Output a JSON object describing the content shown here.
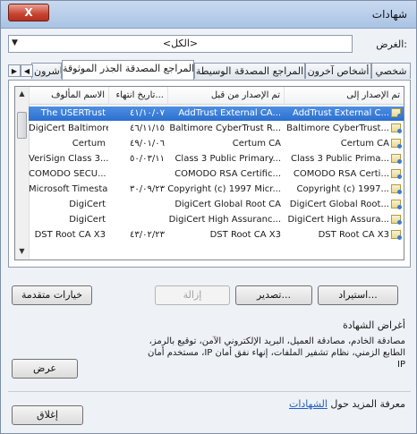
{
  "window": {
    "title": "شهادات",
    "close_label": "X"
  },
  "purpose": {
    "label": "الغرض:",
    "selected": "<الكل>"
  },
  "tabs": [
    {
      "label": "شخصي"
    },
    {
      "label": "أشخاص آخرون"
    },
    {
      "label": "المراجع المصدقة الوسيطة"
    },
    {
      "label": "المراجع المصدقة الجذر الموثوقة"
    },
    {
      "label": "الناشرون"
    }
  ],
  "table": {
    "columns": [
      "تم الإصدار إلى",
      "تم الإصدار من قبل",
      "تاريخ انتهاء...",
      "الاسم المألوف"
    ],
    "rows": [
      {
        "issued_to": "AddTrust External C...",
        "issued_by": "AddTrust External CA...",
        "expiry": "٤١/١٠/٠٧",
        "friendly": "The USERTrust"
      },
      {
        "issued_to": "Baltimore CyberTrust...",
        "issued_by": "Baltimore CyberTrust R...",
        "expiry": "٤٦/١١/١٥",
        "friendly": "DigiCert Baltimore..."
      },
      {
        "issued_to": "Certum CA",
        "issued_by": "Certum CA",
        "expiry": "٤٩/٠١/٠٦",
        "friendly": "Certum"
      },
      {
        "issued_to": "Class 3 Public Prima...",
        "issued_by": "Class 3 Public Primary...",
        "expiry": "٥٠/٠٣/١١",
        "friendly": "VeriSign Class 3..."
      },
      {
        "issued_to": "COMODO RSA Certi...",
        "issued_by": "COMODO RSA Certific...",
        "expiry": "",
        "friendly": "COMODO SECU..."
      },
      {
        "issued_to": "Copyright (c) 1997...",
        "issued_by": "Copyright (c) 1997 Micr...",
        "expiry": "٣٠/٠٩/٢٣",
        "friendly": "Microsoft Timesta..."
      },
      {
        "issued_to": "DigiCert Global Root...",
        "issued_by": "DigiCert Global Root CA",
        "expiry": "",
        "friendly": "DigiCert"
      },
      {
        "issued_to": "DigiCert High Assura...",
        "issued_by": "DigiCert High Assuranc...",
        "expiry": "",
        "friendly": "DigiCert"
      },
      {
        "issued_to": "DST Root CA X3",
        "issued_by": "DST Root CA X3",
        "expiry": "٤٣/٠٢/٢٣",
        "friendly": "DST Root CA X3"
      }
    ]
  },
  "buttons": {
    "import": "استيراد...",
    "export": "تصدير...",
    "remove": "إزالة",
    "advanced": "خيارات متقدمة",
    "view": "عرض",
    "close": "إغلاق"
  },
  "details": {
    "section_label": "أغراض الشهادة",
    "purposes_text": "مصادقة الخادم، مصادقة العميل، البريد الإلكتروني الآمن، توقيع بالرمز، الطابع الزمني، نظام تشفير الملفات، إنهاء نفق أمان IP، مستخدم أمان IP"
  },
  "learn_more": {
    "prefix": "معرفة المزيد حول",
    "link": "الشهادات"
  }
}
